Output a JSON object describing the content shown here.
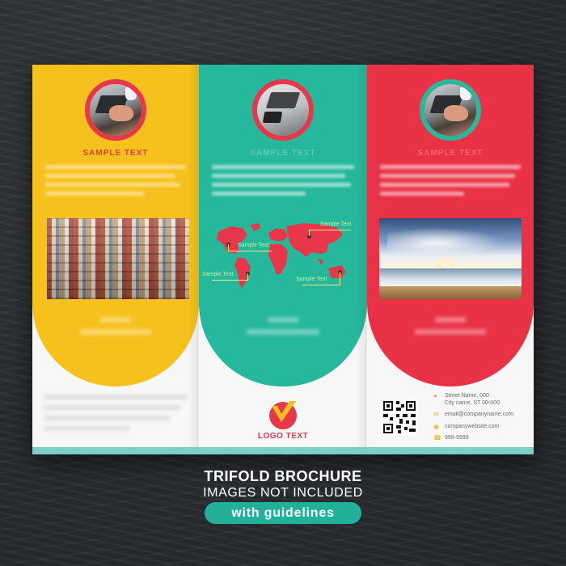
{
  "brochure": {
    "panels": [
      {
        "id": "left",
        "color": "#f6c11d",
        "title": "SAMPLE TEXT"
      },
      {
        "id": "middle",
        "color": "#26b89b",
        "map_labels": [
          "Sample Text",
          "Sample Text",
          "Sample Text",
          "Sample Text"
        ]
      },
      {
        "id": "right",
        "color": "#ea3246"
      }
    ],
    "logo": {
      "text": "LOGO TEXT"
    },
    "contact": {
      "address_line1": "Street Name, 000",
      "address_line2": "City name, ST 00-000",
      "email": "email@companyname.com",
      "website": "companywebsite.com",
      "phone": "999-9999"
    },
    "accent_red": "#e8374b",
    "accent_yellow": "#f2b827",
    "accent_teal": "#22b09a"
  },
  "caption": {
    "title": "TRIFOLD BROCHURE",
    "subtitle": "IMAGES NOT INCLUDED",
    "badge": "with guidelines"
  },
  "icons": [
    "location-pin-icon",
    "mail-icon",
    "globe-icon",
    "phone-icon",
    "qr-code-icon"
  ]
}
